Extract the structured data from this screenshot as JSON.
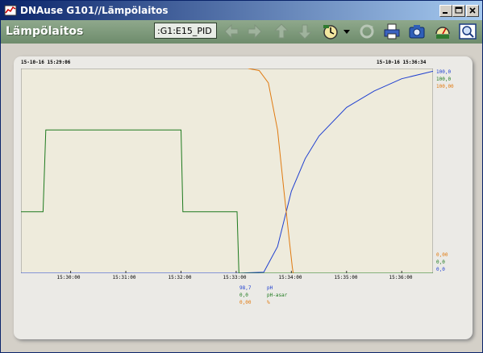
{
  "window": {
    "title": "DNAuse G101//Lämpölaitos"
  },
  "toolbar": {
    "title": "Lämpölaitos",
    "address_value": ":G1:E15_PID"
  },
  "chart": {
    "start_time": "15-10-16 15:29:06",
    "end_time": "15-10-16 15:36:34",
    "right_top": [
      "100,0",
      "100,0",
      "100,00"
    ],
    "right_bottom": [
      "0,00",
      "0,0",
      "0,0"
    ],
    "x_ticks": [
      "15:30:00",
      "15:31:00",
      "15:32:00",
      "15:33:00",
      "15:34:00",
      "15:35:00",
      "15:36:00"
    ],
    "legend": [
      {
        "value": "98,7",
        "name": "pH",
        "color": "#1f3fd0"
      },
      {
        "value": "0,0",
        "name": "pH-asar",
        "color": "#1e7a1e"
      },
      {
        "value": "0,00",
        "name": "%",
        "color": "#e07a10"
      }
    ]
  },
  "chart_data": {
    "type": "line",
    "x_range": [
      "15:29:06",
      "15:36:34"
    ],
    "series": [
      {
        "name": "pH",
        "color": "#1f3fd0",
        "x": [
          "15:29:06",
          "15:33:00",
          "15:33:30",
          "15:33:45",
          "15:34:00",
          "15:34:15",
          "15:34:30",
          "15:35:00",
          "15:35:30",
          "15:36:00",
          "15:36:34"
        ],
        "y": [
          0,
          0,
          0.5,
          13,
          40,
          56,
          67,
          81,
          89,
          95,
          98.7
        ]
      },
      {
        "name": "pH-asar",
        "color": "#1e7a1e",
        "x": [
          "15:29:06",
          "15:29:30",
          "15:29:33",
          "15:32:00",
          "15:32:02",
          "15:33:01",
          "15:33:03",
          "15:36:34"
        ],
        "y": [
          30,
          30,
          70,
          70,
          30,
          30,
          0,
          0
        ]
      },
      {
        "name": "%",
        "color": "#e07a10",
        "x": [
          "15:33:13",
          "15:33:25",
          "15:33:35",
          "15:33:45",
          "15:33:52",
          "15:33:58",
          "15:34:01",
          "15:34:02"
        ],
        "y": [
          100,
          99,
          93,
          70,
          40,
          15,
          3,
          0
        ]
      }
    ],
    "ylim": [
      0,
      100
    ]
  }
}
